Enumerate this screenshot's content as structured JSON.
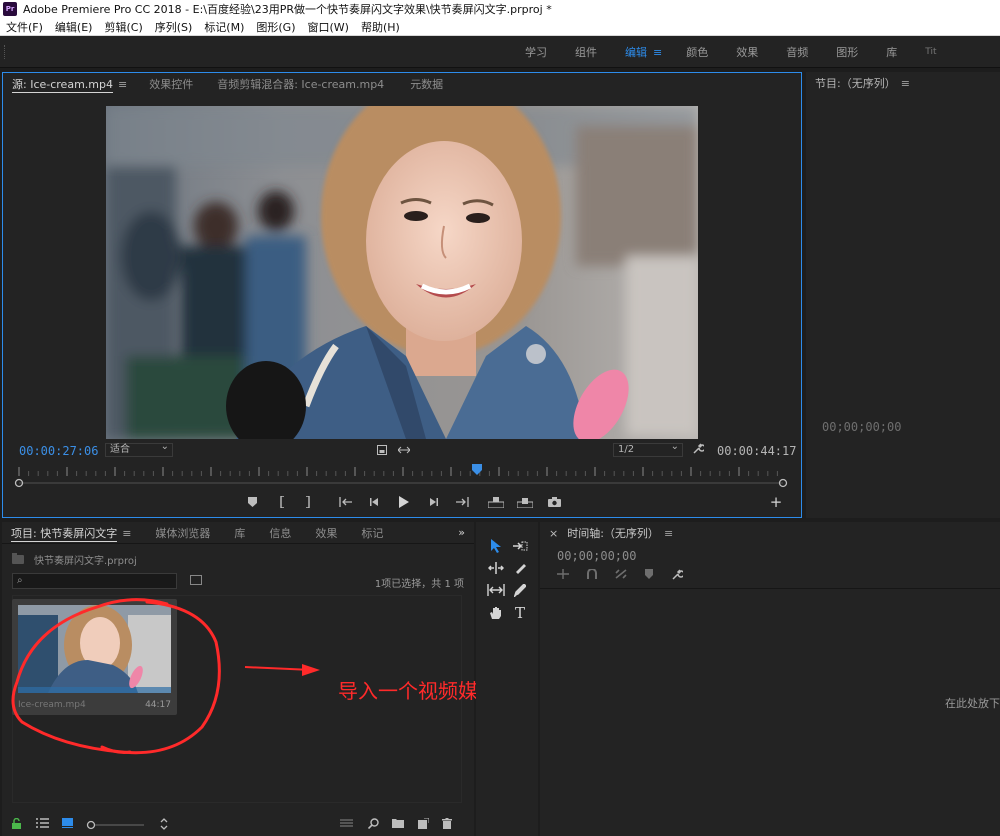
{
  "window": {
    "logo": "Pr",
    "title": "Adobe Premiere Pro CC 2018 - E:\\百度经验\\23用PR做一个快节奏屏闪文字效果\\快节奏屏闪文字.prproj *"
  },
  "menu": [
    "文件(F)",
    "编辑(E)",
    "剪辑(C)",
    "序列(S)",
    "标记(M)",
    "图形(G)",
    "窗口(W)",
    "帮助(H)"
  ],
  "workspaces": {
    "items": [
      "学习",
      "组件",
      "编辑",
      "颜色",
      "效果",
      "音频",
      "图形",
      "库",
      "Tit"
    ],
    "active": "编辑",
    "menu_glyph": "≡"
  },
  "source_panel": {
    "tabs": [
      "源: Ice-cream.mp4",
      "效果控件",
      "音频剪辑混合器: Ice-cream.mp4",
      "元数据"
    ],
    "menu_glyph": "≡",
    "current_timecode": "00:00:27:06",
    "duration_timecode": "00:00:44:17",
    "fit": "适合",
    "resolution": "1/2",
    "playhead_fraction": 0.6
  },
  "program_panel": {
    "tab": "节目:（无序列）",
    "menu_glyph": "≡",
    "timecode": "00;00;00;00"
  },
  "project_panel": {
    "tabs": [
      "项目: 快节奏屏闪文字",
      "媒体浏览器",
      "库",
      "信息",
      "效果",
      "标记"
    ],
    "menu_glyph": "≡",
    "overflow_glyph": "»",
    "project_file": "快节奏屏闪文字.prproj",
    "search_placeholder": "",
    "search_glyph": "⌕",
    "selection": "1项已选择，共 1 项",
    "clip": {
      "name": "Ice-cream.mp4",
      "duration": "44:17"
    }
  },
  "annotation": {
    "text": "导入一个视频媒体",
    "color": "#ff2a2a"
  },
  "timeline_panel": {
    "close_glyph": "×",
    "tab": "时间轴:（无序列）",
    "menu_glyph": "≡",
    "timecode": "00;00;00;00",
    "drop_hint": "在此处放下"
  },
  "colors": {
    "accent": "#2d8ceb",
    "panel": "#232323",
    "background": "#1d1d1d"
  }
}
